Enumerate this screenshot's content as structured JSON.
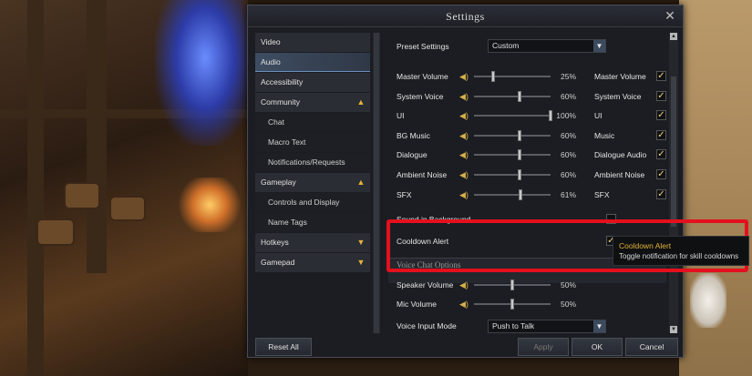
{
  "dialog": {
    "title": "Settings"
  },
  "nav": {
    "items": [
      {
        "label": "Video",
        "type": "cat"
      },
      {
        "label": "Audio",
        "type": "selected"
      },
      {
        "label": "Accessibility",
        "type": "cat"
      },
      {
        "label": "Community",
        "type": "cat",
        "arrow": "up"
      },
      {
        "label": "Chat",
        "type": "sub"
      },
      {
        "label": "Macro Text",
        "type": "sub"
      },
      {
        "label": "Notifications/Requests",
        "type": "sub"
      },
      {
        "label": "Gameplay",
        "type": "cat",
        "arrow": "up"
      },
      {
        "label": "Controls and Display",
        "type": "sub"
      },
      {
        "label": "Name Tags",
        "type": "sub"
      },
      {
        "label": "Hotkeys",
        "type": "cat",
        "arrow": "down"
      },
      {
        "label": "Gamepad",
        "type": "cat",
        "arrow": "down"
      }
    ]
  },
  "preset": {
    "label": "Preset Settings",
    "value": "Custom"
  },
  "volumes": [
    {
      "label": "Master Volume",
      "percent": 25,
      "text": "25%",
      "mute_label": "Master Volume"
    },
    {
      "label": "System Voice",
      "percent": 60,
      "text": "60%",
      "mute_label": "System Voice"
    },
    {
      "label": "UI",
      "percent": 100,
      "text": "100%",
      "mute_label": "UI"
    },
    {
      "label": "BG Music",
      "percent": 60,
      "text": "60%",
      "mute_label": "Music"
    },
    {
      "label": "Dialogue",
      "percent": 60,
      "text": "60%",
      "mute_label": "Dialogue Audio"
    },
    {
      "label": "Ambient Noise",
      "percent": 60,
      "text": "60%",
      "mute_label": "Ambient Noise"
    },
    {
      "label": "SFX",
      "percent": 61,
      "text": "61%",
      "mute_label": "SFX"
    }
  ],
  "sound_in_background": {
    "label": "Sound in Background"
  },
  "cooldown_alert": {
    "label": "Cooldown Alert",
    "checked": true
  },
  "voice_chat": {
    "section_title": "Voice Chat Options",
    "speaker": {
      "label": "Speaker Volume",
      "percent": 50,
      "text": "50%"
    },
    "mic": {
      "label": "Mic Volume",
      "percent": 50,
      "text": "50%"
    },
    "input_mode": {
      "label": "Voice Input Mode",
      "value": "Push to Talk"
    }
  },
  "tooltip": {
    "title": "Cooldown Alert",
    "description": "Toggle notification for skill cooldowns"
  },
  "footer": {
    "reset": "Reset All",
    "apply": "Apply",
    "ok": "OK",
    "cancel": "Cancel"
  },
  "colors": {
    "accent_gold": "#e5b23a",
    "highlight_red": "#e4101d",
    "selected_nav": "#3e4d62"
  },
  "icons": {
    "speaker": "speaker-icon",
    "check": "checkmark-icon",
    "dropdown": "chevron-down-icon",
    "close": "close-icon"
  }
}
